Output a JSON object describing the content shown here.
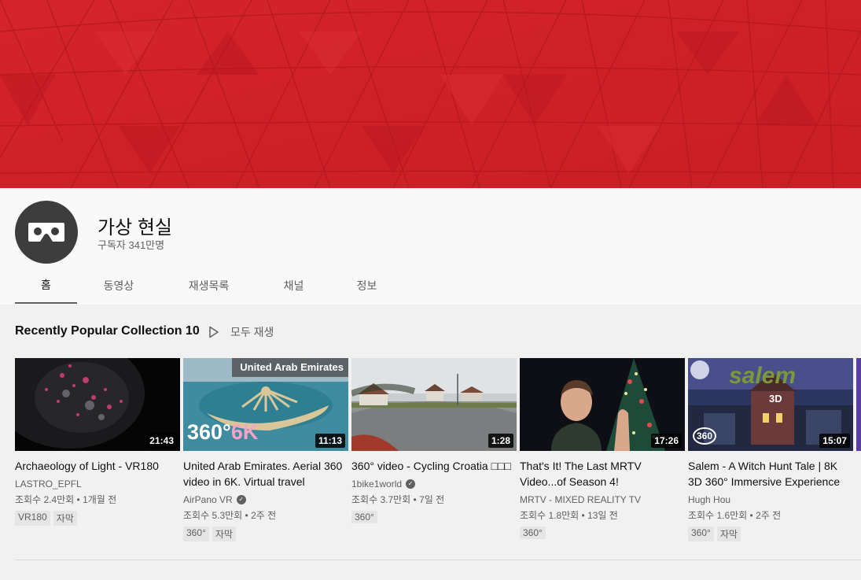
{
  "channel": {
    "name": "가상 현실",
    "subscribers": "구독자 341만명",
    "avatar_icon": "vr-headset-icon",
    "banner_color": "#d62127"
  },
  "tabs": [
    {
      "label": "홈",
      "active": true
    },
    {
      "label": "동영상",
      "active": false
    },
    {
      "label": "재생목록",
      "active": false
    },
    {
      "label": "채널",
      "active": false
    },
    {
      "label": "정보",
      "active": false
    }
  ],
  "shelf": {
    "title": "Recently Popular Collection 10",
    "play_all": "모두 재생"
  },
  "videos": [
    {
      "title": "Archaeology of Light - VR180",
      "channel": "LASTRO_EPFL",
      "verified": false,
      "meta": "조회수 2.4만회 • 1개월 전",
      "duration": "21:43",
      "badges": [
        "VR180",
        "자막"
      ]
    },
    {
      "title": "United Arab Emirates. Aerial 360 video in 6K. Virtual travel",
      "channel": "AirPano VR",
      "verified": true,
      "meta": "조회수 5.3만회 • 2주 전",
      "duration": "11:13",
      "badges": [
        "360°",
        "자막"
      ],
      "overlay_label": "United Arab Emirates",
      "overlay_big": "360°",
      "overlay_k": "6K"
    },
    {
      "title": "360° video - Cycling Croatia □□□",
      "channel": "1bike1world",
      "verified": true,
      "meta": "조회수 3.7만회 • 7일 전",
      "duration": "1:28",
      "badges": [
        "360°"
      ]
    },
    {
      "title": "That's It! The Last MRTV Video...of Season 4!",
      "channel": "MRTV - MIXED REALITY TV",
      "verified": false,
      "meta": "조회수 1.8만회 • 13일 전",
      "duration": "17:26",
      "badges": [
        "360°"
      ]
    },
    {
      "title": "Salem - A Witch Hunt Tale | 8K 3D 360° Immersive Experience",
      "channel": "Hugh Hou",
      "verified": false,
      "meta": "조회수 1.6만회 • 2주 전",
      "duration": "15:07",
      "badges": [
        "360°",
        "자막"
      ],
      "overlay_big": "salem",
      "overlay_3d": "3D",
      "overlay_360": "360"
    }
  ]
}
